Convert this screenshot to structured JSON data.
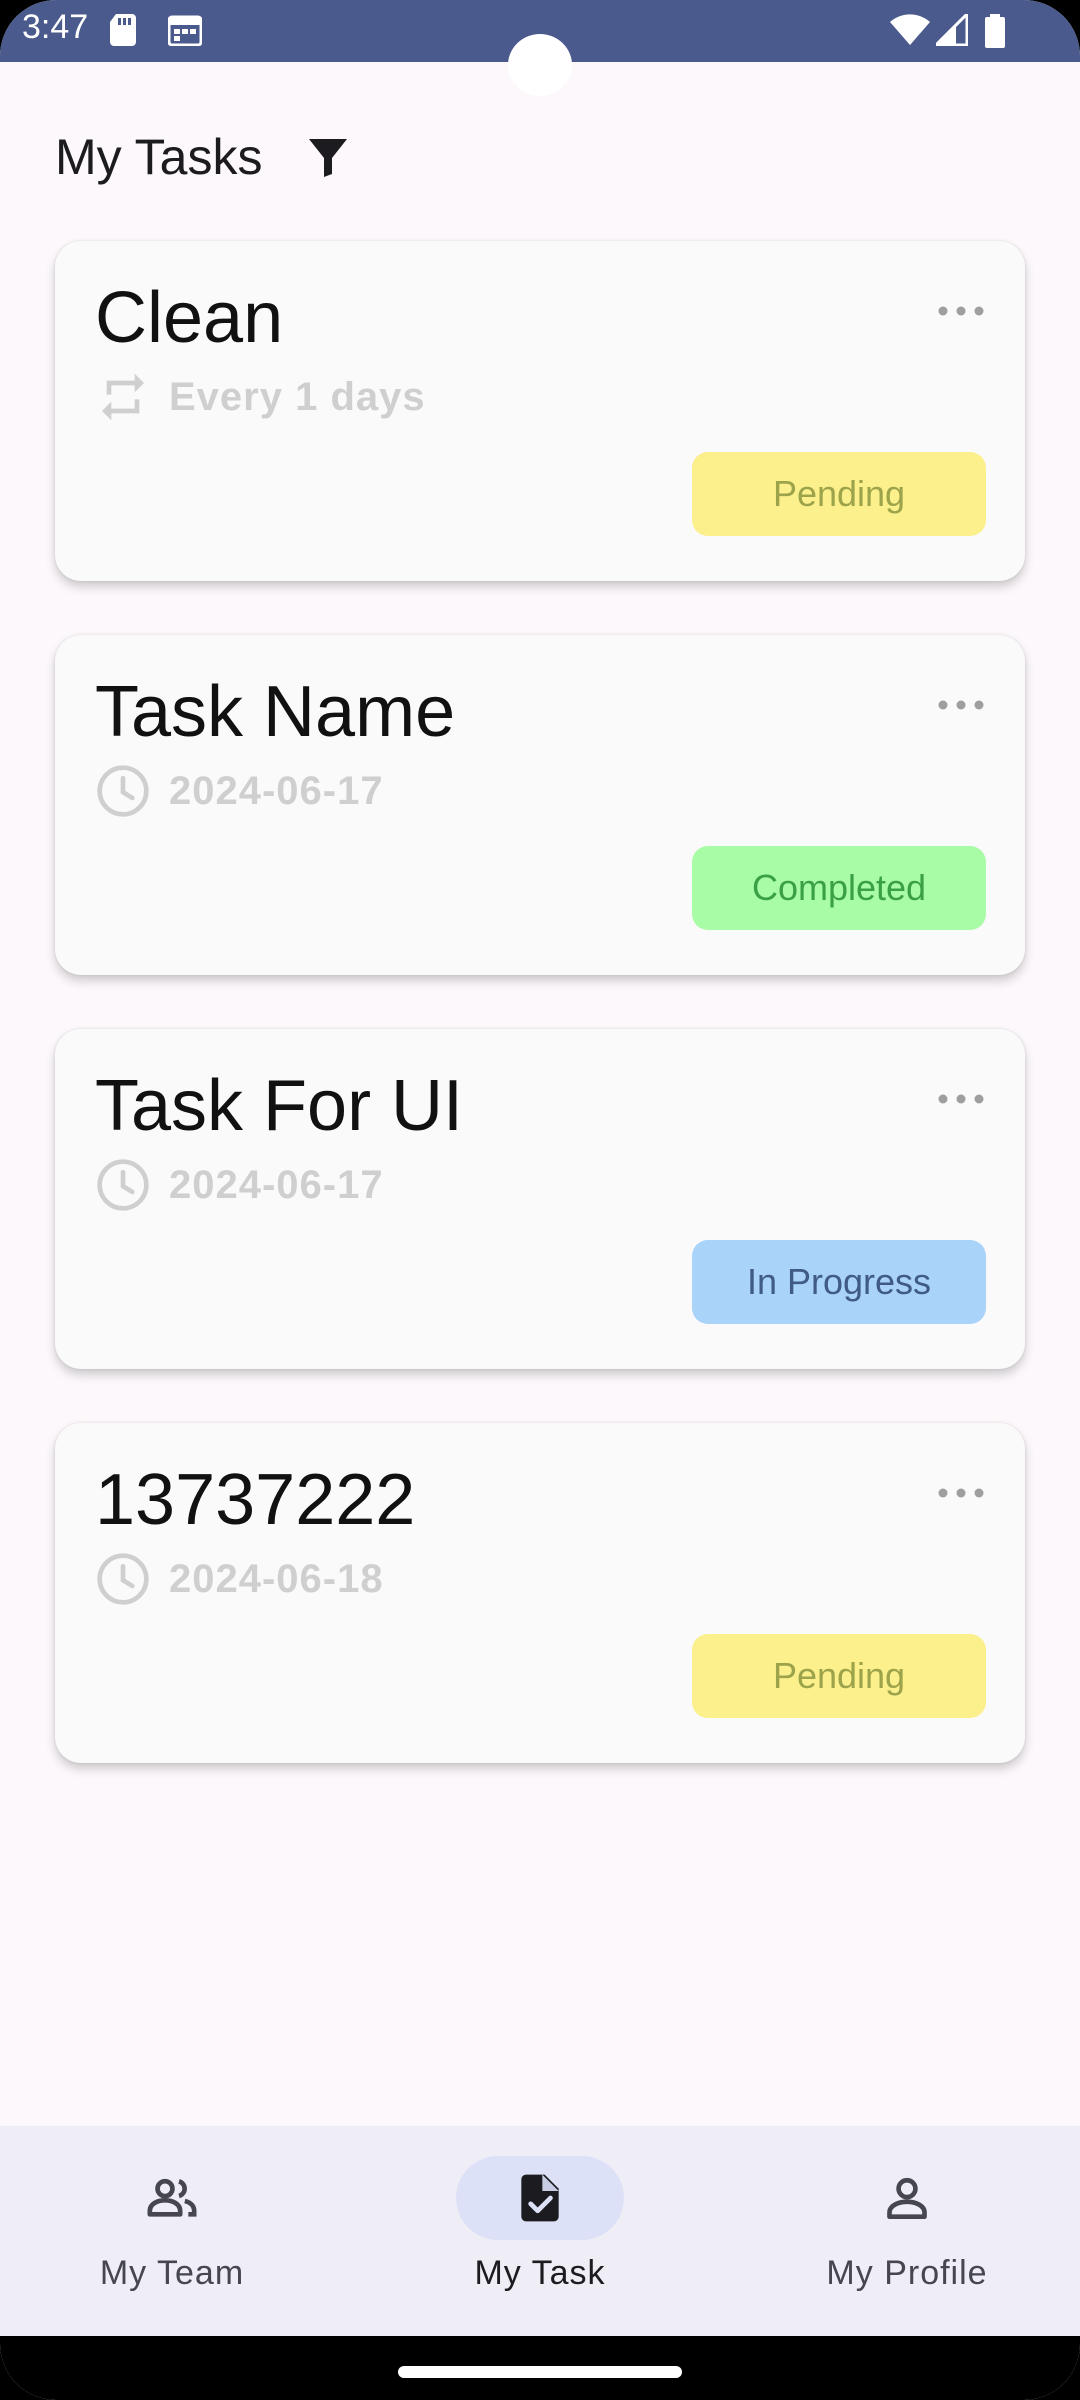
{
  "status_bar": {
    "time": "3:47",
    "left_icons": [
      "sd-card-icon",
      "calendar-icon"
    ],
    "right_icons": [
      "wifi-icon",
      "signal-icon",
      "battery-icon"
    ],
    "color": "#4a5a8c"
  },
  "header": {
    "title": "My Tasks",
    "filter_icon": "filter-icon"
  },
  "tasks": [
    {
      "name": "Clean",
      "meta_icon": "repeat-icon",
      "meta": "Every 1 days",
      "status": "Pending"
    },
    {
      "name": "Task Name",
      "meta_icon": "clock-icon",
      "meta": "2024-06-17",
      "status": "Completed"
    },
    {
      "name": "Task For UI",
      "meta_icon": "clock-icon",
      "meta": "2024-06-17",
      "status": "In Progress"
    },
    {
      "name": "13737222",
      "meta_icon": "clock-icon",
      "meta": "2024-06-18",
      "status": "Pending"
    }
  ],
  "status_colors": {
    "Pending": {
      "bg": "#fbf08b",
      "fg": "#9ca34a"
    },
    "Completed": {
      "bg": "#a9fca6",
      "fg": "#3aa045"
    },
    "In Progress": {
      "bg": "#aad3fa",
      "fg": "#3f5b86"
    }
  },
  "bottom_nav": {
    "items": [
      {
        "label": "My Team",
        "icon": "group-icon",
        "active": false
      },
      {
        "label": "My Task",
        "icon": "task-file-icon",
        "active": true
      },
      {
        "label": "My Profile",
        "icon": "person-icon",
        "active": false
      }
    ]
  }
}
